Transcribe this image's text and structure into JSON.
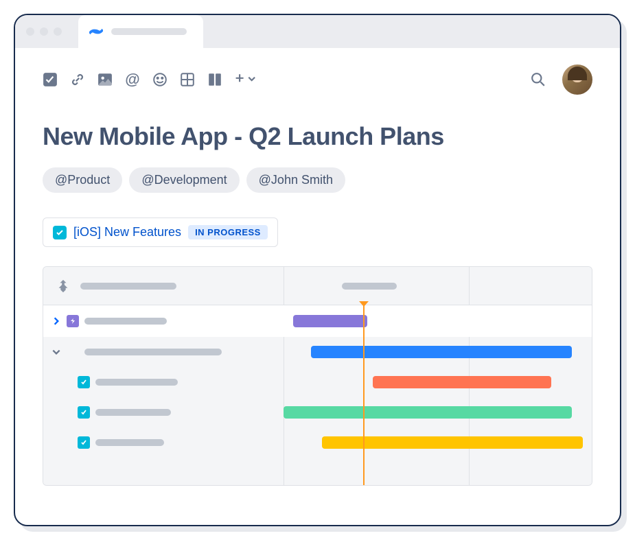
{
  "page": {
    "title": "New Mobile App - Q2 Launch Plans"
  },
  "mentions": [
    {
      "label": "@Product"
    },
    {
      "label": "@Development"
    },
    {
      "label": "@John Smith"
    }
  ],
  "task": {
    "title": "[iOS] New Features",
    "status": "IN PROGRESS"
  },
  "roadmap": {
    "bars": [
      {
        "color": "#8777D9"
      },
      {
        "color": "#2684FF"
      },
      {
        "color": "#FF7452"
      },
      {
        "color": "#57D9A3"
      },
      {
        "color": "#FFC400"
      }
    ]
  }
}
